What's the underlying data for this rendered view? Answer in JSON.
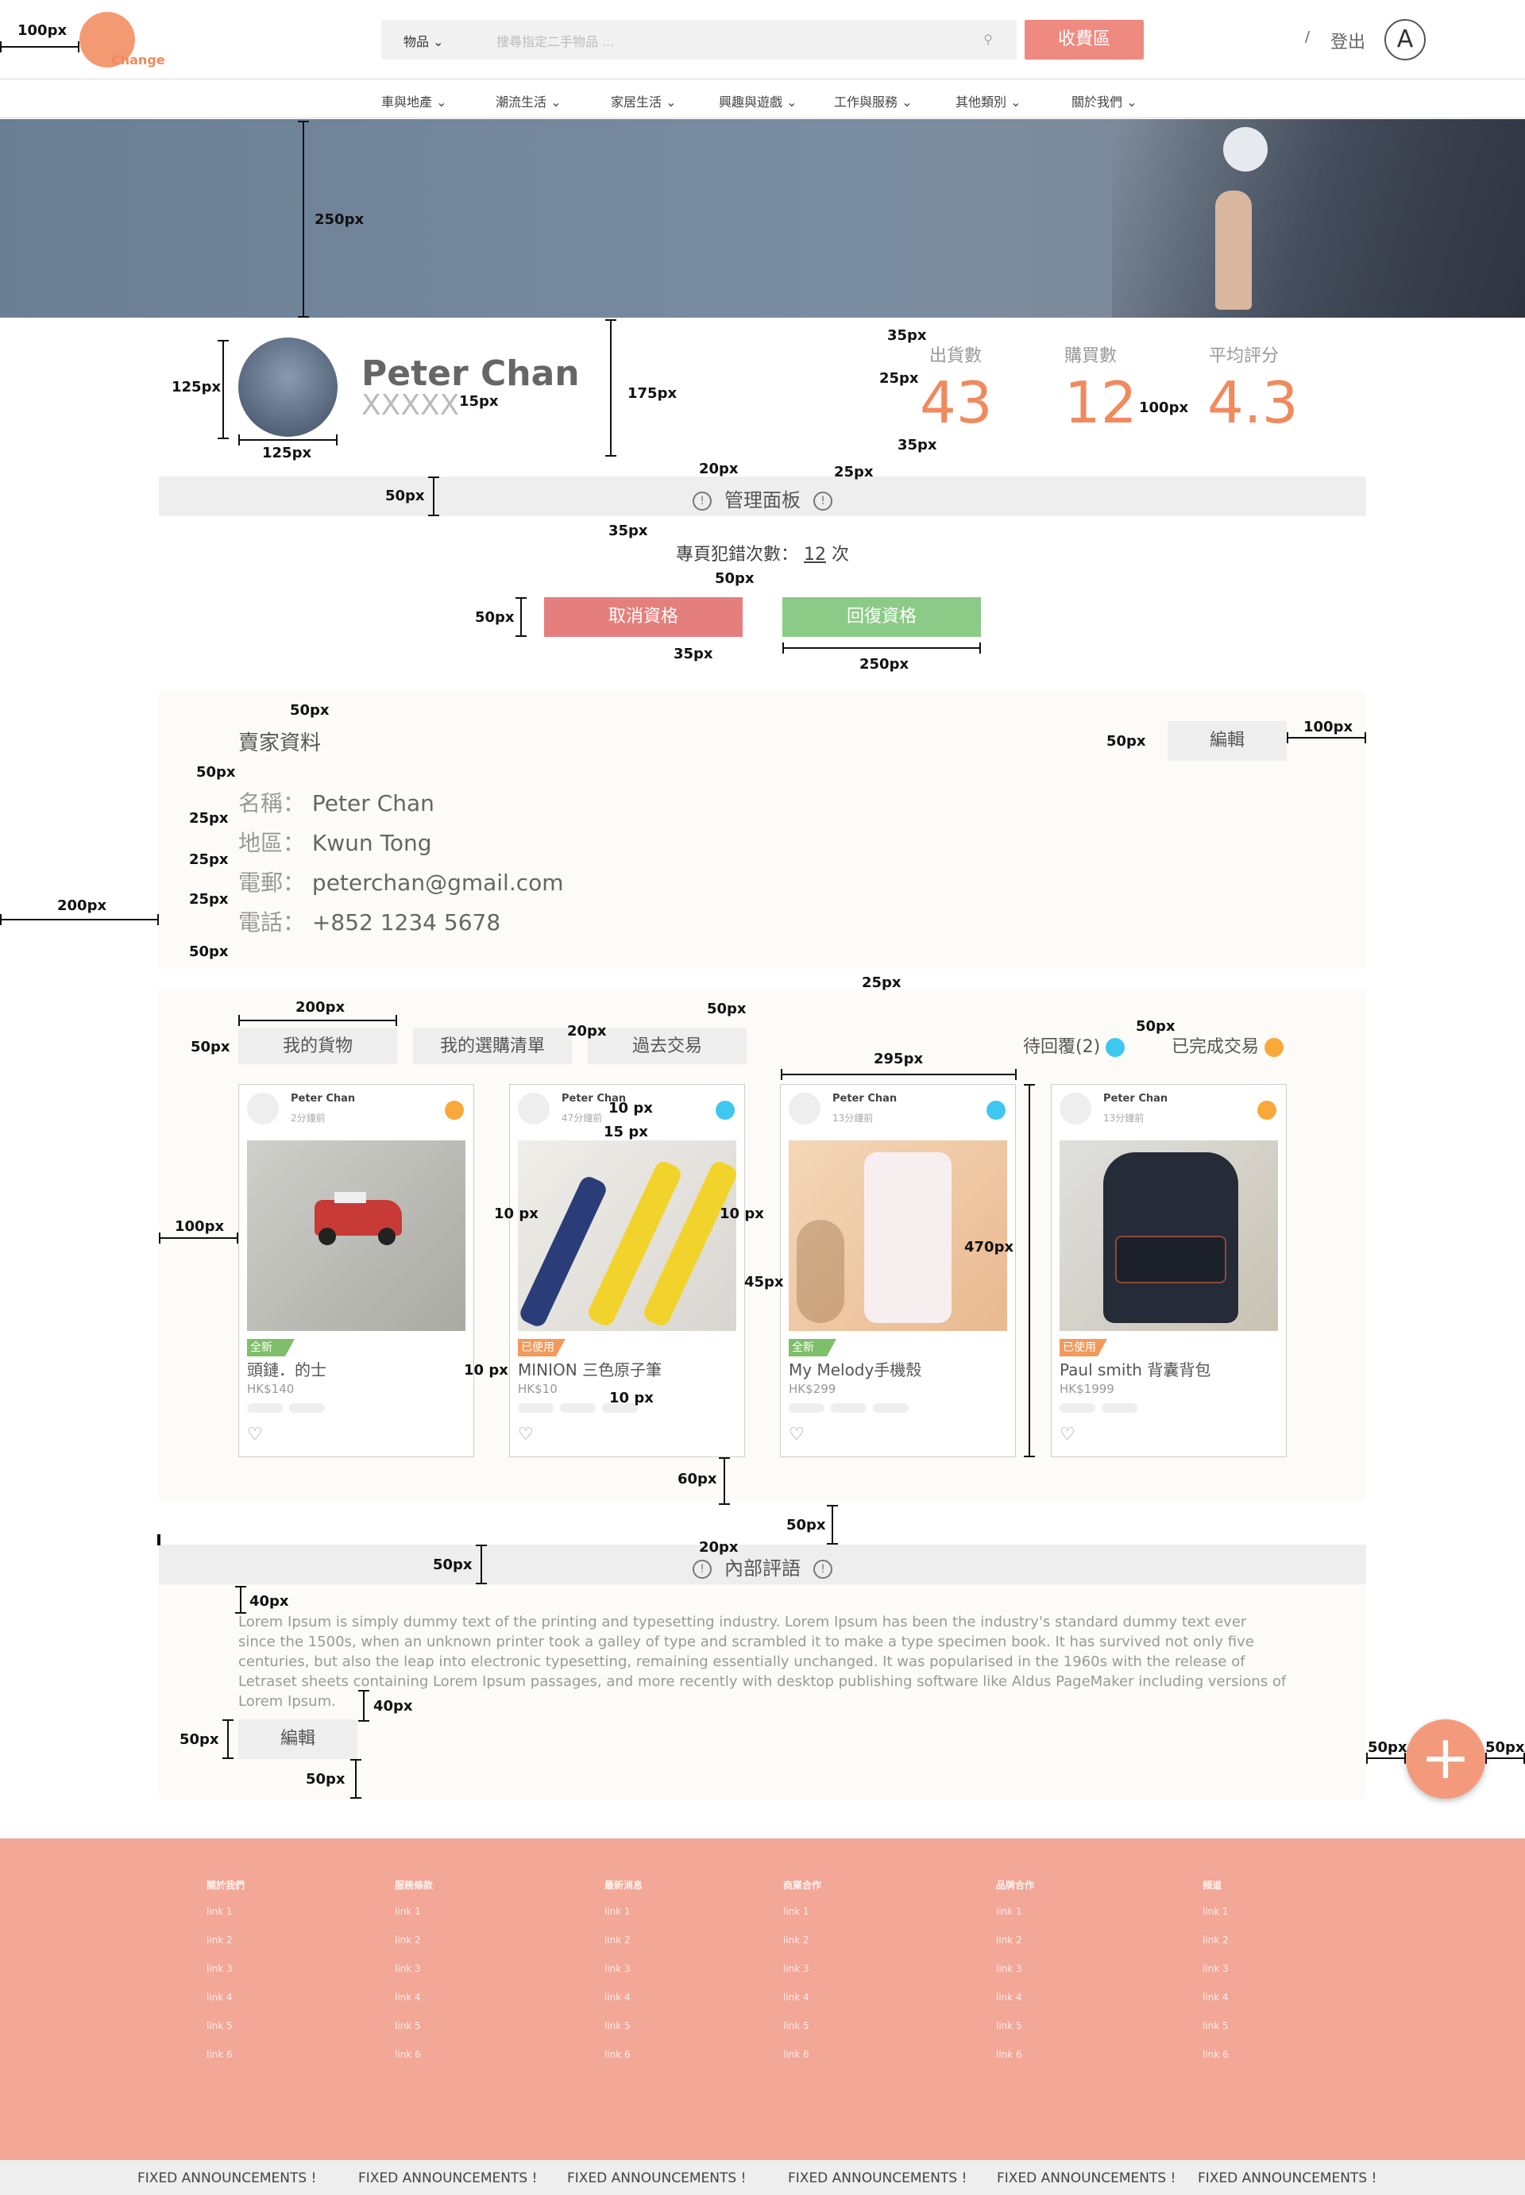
{
  "header": {
    "logo_text": "Change",
    "category_select": "物品",
    "search_placeholder": "搜尋指定二手物品 ...",
    "collect_button": "收費區",
    "logout": "登出",
    "avatar_letter": "A"
  },
  "nav": [
    "車與地產",
    "潮流生活",
    "家居生活",
    "興趣與遊戲",
    "工作與服務",
    "其他類別",
    "關於我們"
  ],
  "profile": {
    "name": "Peter Chan",
    "sub": "XXXXX",
    "stats": [
      {
        "label": "出貨數",
        "value": "43"
      },
      {
        "label": "購買數",
        "value": "12"
      },
      {
        "label": "平均評分",
        "value": "4.3"
      }
    ]
  },
  "admin": {
    "title": "管理面板",
    "error_label": "專頁犯錯次數：",
    "error_value": "12",
    "error_unit": "次",
    "cancel_button": "取消資格",
    "restore_button": "回復資格"
  },
  "seller": {
    "title": "賣家資料",
    "edit_button": "編輯",
    "rows": [
      {
        "key": "名稱：",
        "value": "Peter Chan"
      },
      {
        "key": "地區：",
        "value": "Kwun Tong"
      },
      {
        "key": "電郵：",
        "value": "peterchan@gmail.com"
      },
      {
        "key": "電話：",
        "value": "+852 1234 5678"
      }
    ]
  },
  "goods": {
    "tabs": [
      "我的貨物",
      "我的選購清單",
      "過去交易"
    ],
    "legend_pending": "待回覆(2)",
    "legend_done": "已完成交易",
    "colors": {
      "pending": "#3ec8ef",
      "done": "#f8a93a",
      "new": "#7fbf6a",
      "used": "#f39a5a"
    },
    "cards": [
      {
        "user": "Peter Chan",
        "time": "2分鐘前",
        "status": "done",
        "badge": "全新",
        "badge_type": "new",
        "title": "頭鏈．的士",
        "price": "HK$140"
      },
      {
        "user": "Peter Chan",
        "time": "47分鐘前",
        "status": "pending",
        "badge": "已使用",
        "badge_type": "used",
        "title": "MINION 三色原子筆",
        "price": "HK$10"
      },
      {
        "user": "Peter Chan",
        "time": "13分鐘前",
        "status": "pending",
        "badge": "全新",
        "badge_type": "new",
        "title": "My Melody手機殼",
        "price": "HK$299"
      },
      {
        "user": "Peter Chan",
        "time": "13分鐘前",
        "status": "done",
        "badge": "已使用",
        "badge_type": "used",
        "title": "Paul smith 背囊背包",
        "price": "HK$1999"
      }
    ]
  },
  "review": {
    "title": "內部評語",
    "text": "Lorem Ipsum is simply dummy text of the printing and typesetting industry. Lorem Ipsum has been the industry's standard dummy text ever since the 1500s, when an unknown printer took a galley of type and scrambled it to make a type specimen book. It has survived not only five centuries, but also the leap into electronic typesetting, remaining essentially unchanged. It was popularised in the 1960s with the release of Letraset sheets containing Lorem Ipsum passages, and more recently with desktop publishing software like Aldus PageMaker including versions of Lorem Ipsum.",
    "edit_button": "編輯"
  },
  "fab": "+",
  "footer": {
    "columns": [
      {
        "head": "關於我們",
        "links": [
          "link 1",
          "link 2",
          "link 3",
          "link 4",
          "link 5",
          "link 6"
        ]
      },
      {
        "head": "服務條款",
        "links": [
          "link 1",
          "link 2",
          "link 3",
          "link 4",
          "link 5",
          "link 6"
        ]
      },
      {
        "head": "最新消息",
        "links": [
          "link 1",
          "link 2",
          "link 3",
          "link 4",
          "link 5",
          "link 6"
        ]
      },
      {
        "head": "商業合作",
        "links": [
          "link 1",
          "link 2",
          "link 3",
          "link 4",
          "link 5",
          "link 6"
        ]
      },
      {
        "head": "品牌合作",
        "links": [
          "link 1",
          "link 2",
          "link 3",
          "link 4",
          "link 5",
          "link 6"
        ]
      },
      {
        "head": "頻道",
        "links": [
          "link 1",
          "link 2",
          "link 3",
          "link 4",
          "link 5",
          "link 6"
        ]
      }
    ]
  },
  "announcement": "FIXED ANNOUNCEMENTS !",
  "annotations": [
    "100px",
    "250px",
    "125px",
    "125px",
    "15px",
    "175px",
    "35px",
    "25px",
    "35px",
    "25px",
    "20px",
    "50px",
    "35px",
    "50px",
    "50px",
    "35px",
    "250px",
    "50px",
    "50px",
    "25px",
    "25px",
    "25px",
    "50px",
    "200px",
    "50px",
    "100px",
    "25px",
    "50px",
    "200px",
    "50px",
    "20px",
    "50px",
    "295px",
    "10 px",
    "15 px",
    "10 px",
    "10 px",
    "100px",
    "45px",
    "470px",
    "10 px",
    "10 px",
    "60px",
    "50px",
    "20px",
    "50px",
    "40px",
    "40px",
    "50px",
    "50px",
    "50px",
    "50px",
    "100px"
  ]
}
